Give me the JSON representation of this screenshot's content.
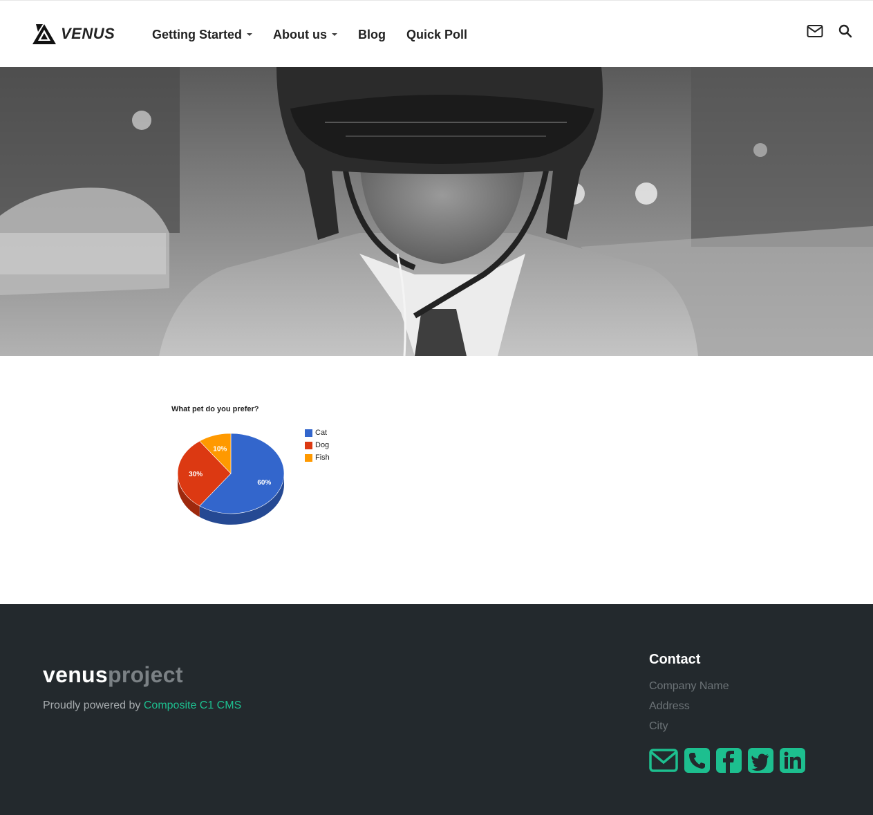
{
  "header": {
    "logo_text": "VENUS",
    "nav": [
      {
        "label": "Getting Started",
        "dropdown": true
      },
      {
        "label": "About us",
        "dropdown": true
      },
      {
        "label": "Blog",
        "dropdown": false
      },
      {
        "label": "Quick Poll",
        "dropdown": false
      }
    ],
    "icons": [
      "envelope-icon",
      "search-icon"
    ]
  },
  "hero": {
    "description_icon": "hero-photo"
  },
  "chart_data": {
    "type": "pie",
    "title": "What pet do you prefer?",
    "categories": [
      "Cat",
      "Dog",
      "Fish"
    ],
    "values": [
      60,
      30,
      10
    ],
    "value_labels": [
      "60%",
      "30%",
      "10%"
    ],
    "colors": [
      "#3366cc",
      "#dc3912",
      "#ff9900"
    ],
    "legend_position": "right"
  },
  "footer": {
    "brand_part1": "venus",
    "brand_part2": "project",
    "powered_prefix": "Proudly powered by ",
    "powered_link": "Composite C1 CMS",
    "contact_title": "Contact",
    "contact_lines": [
      "Company Name",
      "Address",
      "City"
    ],
    "social_icons": [
      "envelope-icon",
      "phone-icon",
      "facebook-icon",
      "twitter-icon",
      "linkedin-icon"
    ],
    "accent_color": "#1dbf8f",
    "background_color": "#23292d"
  }
}
